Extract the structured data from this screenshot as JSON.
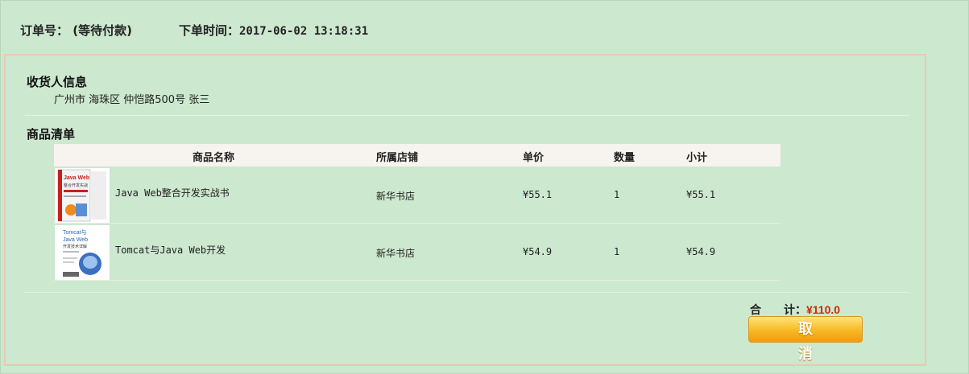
{
  "order": {
    "number_label": "订单号：",
    "status": "(等待付款)",
    "time_label": "下单时间：",
    "time_value": "2017-06-02 13:18:31"
  },
  "receiver": {
    "title": "收货人信息",
    "address": "广州市 海珠区 仲恺路500号 张三"
  },
  "goods": {
    "title": "商品清单",
    "columns": [
      "商品名称",
      "所属店铺",
      "单价",
      "数量",
      "小计"
    ],
    "rows": [
      {
        "name": "Java Web整合开发实战书",
        "shop": "新华书店",
        "price": "¥55.1",
        "qty": "1",
        "subtotal": "¥55.1",
        "cover_text": [
          "Java Web",
          "整合开发实战"
        ]
      },
      {
        "name": "Tomcat与Java Web开发",
        "shop": "新华书店",
        "price": "¥54.9",
        "qty": "1",
        "subtotal": "¥54.9",
        "cover_text": [
          "Tomcat与",
          "Java Web",
          "开发技术详解"
        ]
      }
    ]
  },
  "summary": {
    "total_label": "合　　计：",
    "total_value": "¥110.0",
    "cancel_label": "取消"
  },
  "colors": {
    "background": "#cce8cf",
    "panel_border": "#e8c9b4",
    "total_price": "#d02a00",
    "button": "#f7b823"
  }
}
